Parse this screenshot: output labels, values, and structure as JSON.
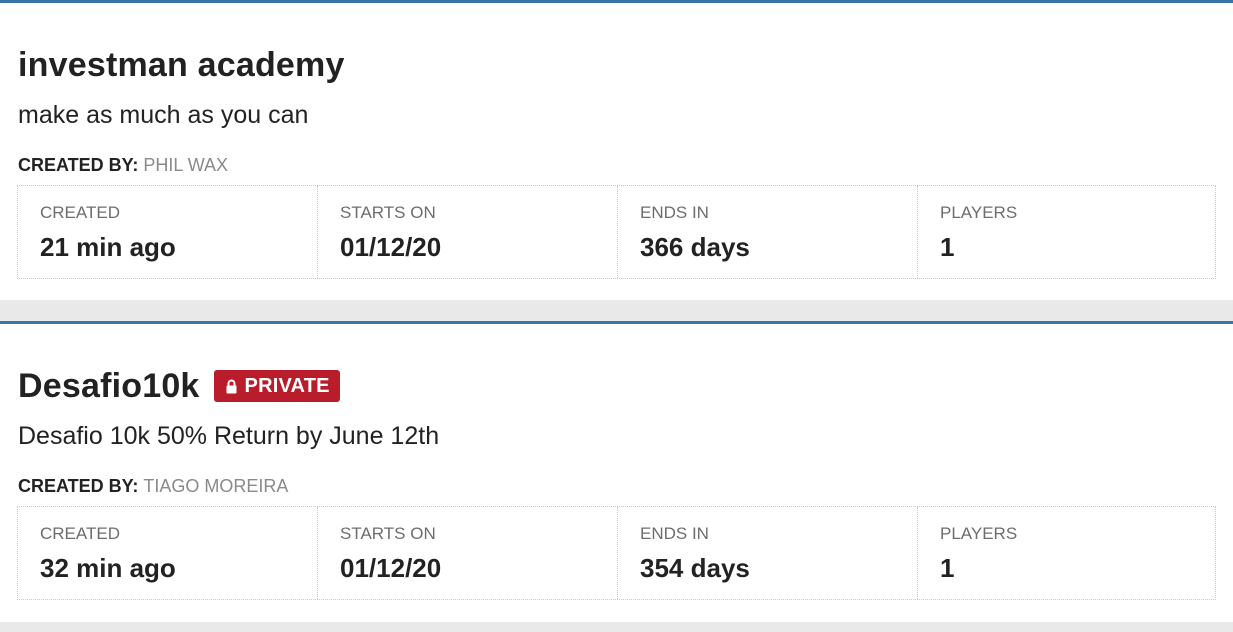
{
  "challenges": [
    {
      "title": "investman academy",
      "private": false,
      "badge": "",
      "description": "make as much as you can",
      "created_by_label": "CREATED BY:",
      "creator": "PHIL WAX",
      "stats": [
        {
          "label": "CREATED",
          "value": "21 min ago"
        },
        {
          "label": "STARTS ON",
          "value": "01/12/20"
        },
        {
          "label": "ENDS IN",
          "value": "366 days"
        },
        {
          "label": "PLAYERS",
          "value": "1"
        }
      ]
    },
    {
      "title": "Desafio10k",
      "private": true,
      "badge": "PRIVATE",
      "badge_icon": "lock-icon",
      "description": "Desafio 10k 50% Return by June 12th",
      "created_by_label": "CREATED BY:",
      "creator": "TIAGO MOREIRA",
      "stats": [
        {
          "label": "CREATED",
          "value": "32 min ago"
        },
        {
          "label": "STARTS ON",
          "value": "01/12/20"
        },
        {
          "label": "ENDS IN",
          "value": "354 days"
        },
        {
          "label": "PLAYERS",
          "value": "1"
        }
      ]
    }
  ],
  "colors": {
    "accent": "#3a74a8",
    "private_badge": "#b91d2b",
    "page_background": "#e9e9e9"
  }
}
